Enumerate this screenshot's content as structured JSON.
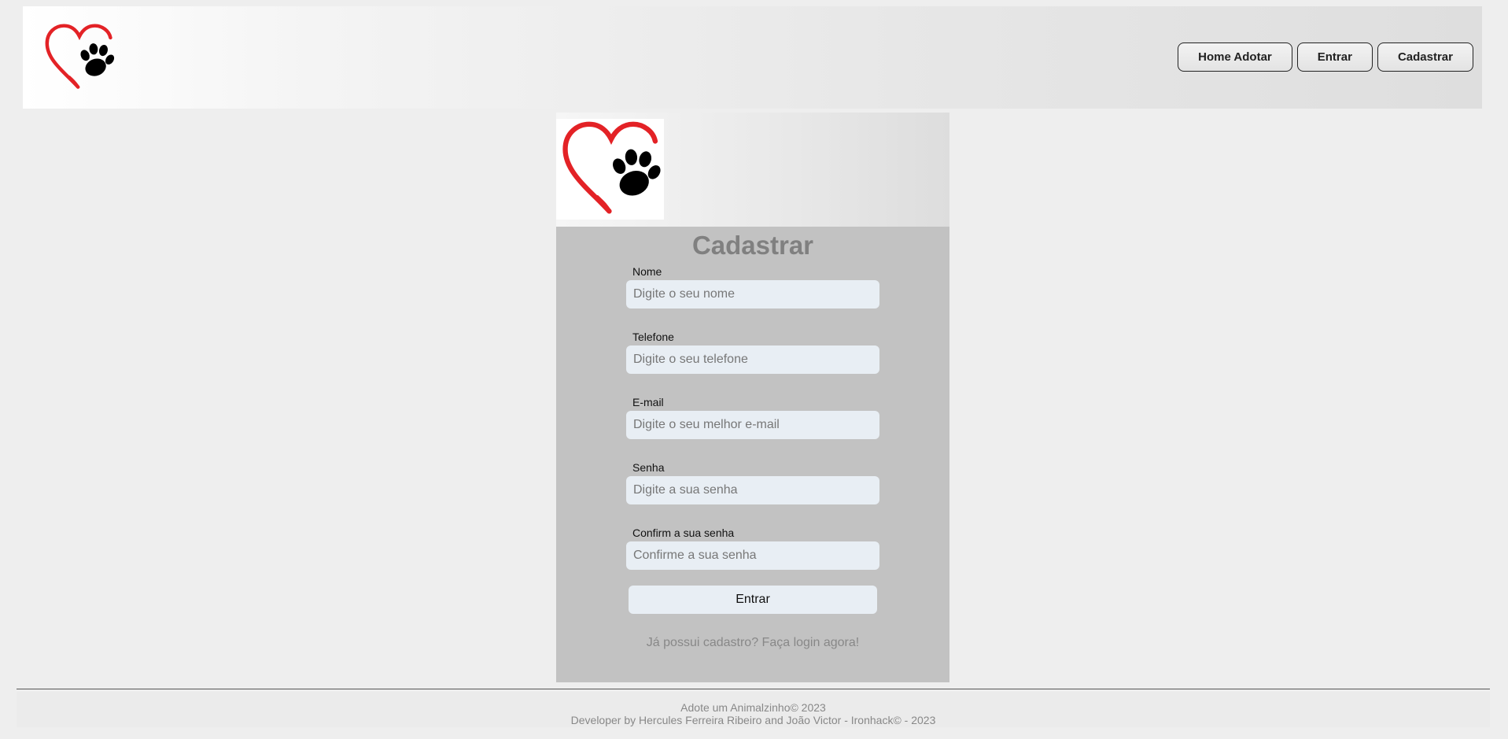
{
  "header": {
    "logo_icon": "heart-paw-icon",
    "nav": {
      "home_adotar": "Home Adotar",
      "entrar": "Entrar",
      "cadastrar": "Cadastrar"
    }
  },
  "form": {
    "logo_icon": "heart-paw-icon",
    "title": "Cadastrar",
    "fields": {
      "nome": {
        "label": "Nome",
        "placeholder": "Digite o seu nome"
      },
      "telefone": {
        "label": "Telefone",
        "placeholder": "Digite o seu telefone"
      },
      "email": {
        "label": "E-mail",
        "placeholder": "Digite o seu melhor e-mail"
      },
      "senha": {
        "label": "Senha",
        "placeholder": "Digite a sua senha"
      },
      "confirm": {
        "label": "Confirm a sua senha",
        "placeholder": "Confirme a sua senha"
      }
    },
    "submit_label": "Entrar",
    "login_link": "Já possui cadastro? Faça login agora!"
  },
  "footer": {
    "line1": "Adote um Animalzinho© 2023",
    "line2": "Developer by Hercules Ferreira Ribeiro and João Victor - Ironhack© - 2023"
  },
  "colors": {
    "heart": "#e32226",
    "paw": "#000000",
    "form_bg": "#c2c2c2",
    "input_bg": "#e8eef4"
  }
}
